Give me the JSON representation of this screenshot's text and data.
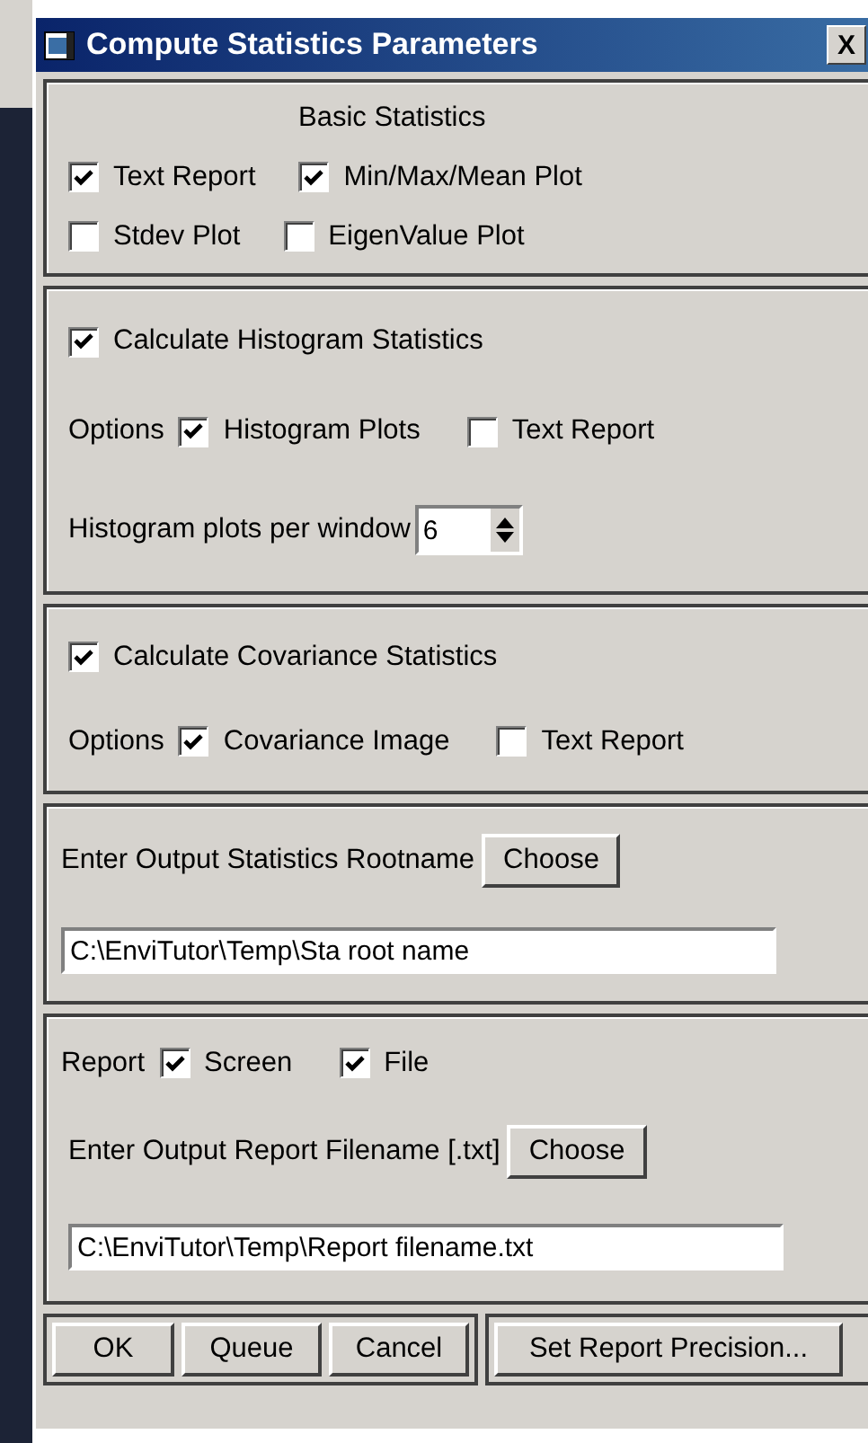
{
  "window": {
    "title": "Compute Statistics Parameters",
    "close": "X"
  },
  "basic": {
    "heading": "Basic Statistics",
    "rows": [
      [
        {
          "label": "Text Report",
          "checked": true
        },
        {
          "label": "Min/Max/Mean Plot",
          "checked": true
        }
      ],
      [
        {
          "label": "Stdev Plot",
          "checked": false
        },
        {
          "label": "EigenValue Plot",
          "checked": false
        }
      ]
    ]
  },
  "histogram": {
    "enabled": {
      "label": "Calculate Histogram Statistics",
      "checked": true
    },
    "options_label": "Options",
    "options": [
      {
        "label": "Histogram Plots",
        "checked": true
      },
      {
        "label": "Text Report",
        "checked": false
      }
    ],
    "plots_label": "Histogram plots per window",
    "plots_value": "6"
  },
  "covariance": {
    "enabled": {
      "label": "Calculate Covariance Statistics",
      "checked": true
    },
    "options_label": "Options",
    "options": [
      {
        "label": "Covariance Image",
        "checked": true
      },
      {
        "label": "Text Report",
        "checked": false
      }
    ]
  },
  "rootname": {
    "label": "Enter Output Statistics Rootname",
    "button": "Choose",
    "value": "C:\\EnviTutor\\Temp\\Sta root name"
  },
  "report": {
    "label": "Report",
    "options": [
      {
        "label": "Screen",
        "checked": true
      },
      {
        "label": "File",
        "checked": true
      }
    ],
    "filename_label": "Enter Output Report Filename [.txt]",
    "button": "Choose",
    "value": "C:\\EnviTutor\\Temp\\Report filename.txt"
  },
  "buttons": [
    "OK",
    "Queue",
    "Cancel"
  ],
  "precision_button": "Set Report Precision..."
}
